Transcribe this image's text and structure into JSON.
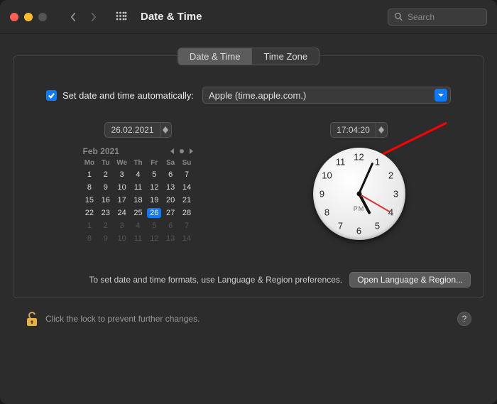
{
  "header": {
    "title": "Date & Time",
    "search_placeholder": "Search"
  },
  "tabs": {
    "date_time": "Date & Time",
    "time_zone": "Time Zone",
    "active": 0
  },
  "auto": {
    "checked": true,
    "label": "Set date and time automatically:",
    "server": "Apple (time.apple.com.)"
  },
  "date_field": "26.02.2021",
  "time_field": "17:04:20",
  "calendar": {
    "month_label": "Feb 2021",
    "weekdays": [
      "Mo",
      "Tu",
      "We",
      "Th",
      "Fr",
      "Sa",
      "Su"
    ],
    "weeks": [
      [
        {
          "d": 1
        },
        {
          "d": 2
        },
        {
          "d": 3
        },
        {
          "d": 4
        },
        {
          "d": 5
        },
        {
          "d": 6
        },
        {
          "d": 7
        }
      ],
      [
        {
          "d": 8
        },
        {
          "d": 9
        },
        {
          "d": 10
        },
        {
          "d": 11
        },
        {
          "d": 12
        },
        {
          "d": 13
        },
        {
          "d": 14
        }
      ],
      [
        {
          "d": 15
        },
        {
          "d": 16
        },
        {
          "d": 17
        },
        {
          "d": 18
        },
        {
          "d": 19
        },
        {
          "d": 20
        },
        {
          "d": 21
        }
      ],
      [
        {
          "d": 22
        },
        {
          "d": 23
        },
        {
          "d": 24
        },
        {
          "d": 25
        },
        {
          "d": 26,
          "sel": true
        },
        {
          "d": 27
        },
        {
          "d": 28
        }
      ],
      [
        {
          "d": 1,
          "dim": true
        },
        {
          "d": 2,
          "dim": true
        },
        {
          "d": 3,
          "dim": true
        },
        {
          "d": 4,
          "dim": true
        },
        {
          "d": 5,
          "dim": true
        },
        {
          "d": 6,
          "dim": true
        },
        {
          "d": 7,
          "dim": true
        }
      ],
      [
        {
          "d": 8,
          "dim": true
        },
        {
          "d": 9,
          "dim": true
        },
        {
          "d": 10,
          "dim": true
        },
        {
          "d": 11,
          "dim": true
        },
        {
          "d": 12,
          "dim": true
        },
        {
          "d": 13,
          "dim": true
        },
        {
          "d": 14,
          "dim": true
        }
      ]
    ]
  },
  "clock": {
    "numbers": [
      "12",
      "1",
      "2",
      "3",
      "4",
      "5",
      "6",
      "7",
      "8",
      "9",
      "10",
      "11"
    ],
    "ampm": "PM",
    "hour_angle": 152,
    "minute_angle": 24,
    "second_angle": 120
  },
  "hint": "To set date and time formats, use Language & Region preferences.",
  "open_button": "Open Language & Region...",
  "footer": {
    "lock_text": "Click the lock to prevent further changes.",
    "help": "?"
  },
  "colors": {
    "accent": "#0a7bff",
    "arrow": "#ff0000"
  }
}
